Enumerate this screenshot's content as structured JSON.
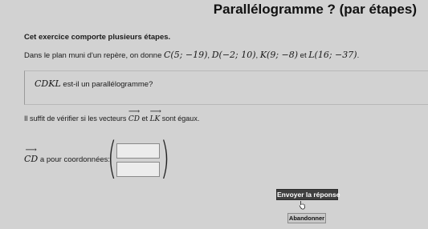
{
  "header": {
    "title": "Parallélogramme ? (par étapes)"
  },
  "exercise": {
    "intro": "Cet exercice comporte plusieurs étapes.",
    "statement_prefix": "Dans le plan muni d'un repère, on donne",
    "point_c": "C(5; −19)",
    "sep1": ",",
    "point_d": "D(−2; 10)",
    "sep2": ",",
    "point_k": "K(9; −8)",
    "and_word": "et",
    "point_l": "L(16; −37)",
    "end": ".",
    "question_shape": "CDKL",
    "question_text": "est-il un parallélogramme?"
  },
  "hint": {
    "prefix": "Il suffit de vérifier si les vecteurs",
    "vector1": "CD",
    "and_word": "et",
    "vector2": "LK",
    "suffix": "sont égaux."
  },
  "answer": {
    "vector": "CD",
    "label": "a pour coordonnées:",
    "x_value": "",
    "y_value": ""
  },
  "buttons": {
    "submit_label": "Envoyer la réponse",
    "abandon_label": "Abandonner"
  },
  "colors": {
    "background": "#d2d2d2",
    "submit_bg": "#3f3f3f",
    "abandon_bg": "#c9c9c9"
  }
}
